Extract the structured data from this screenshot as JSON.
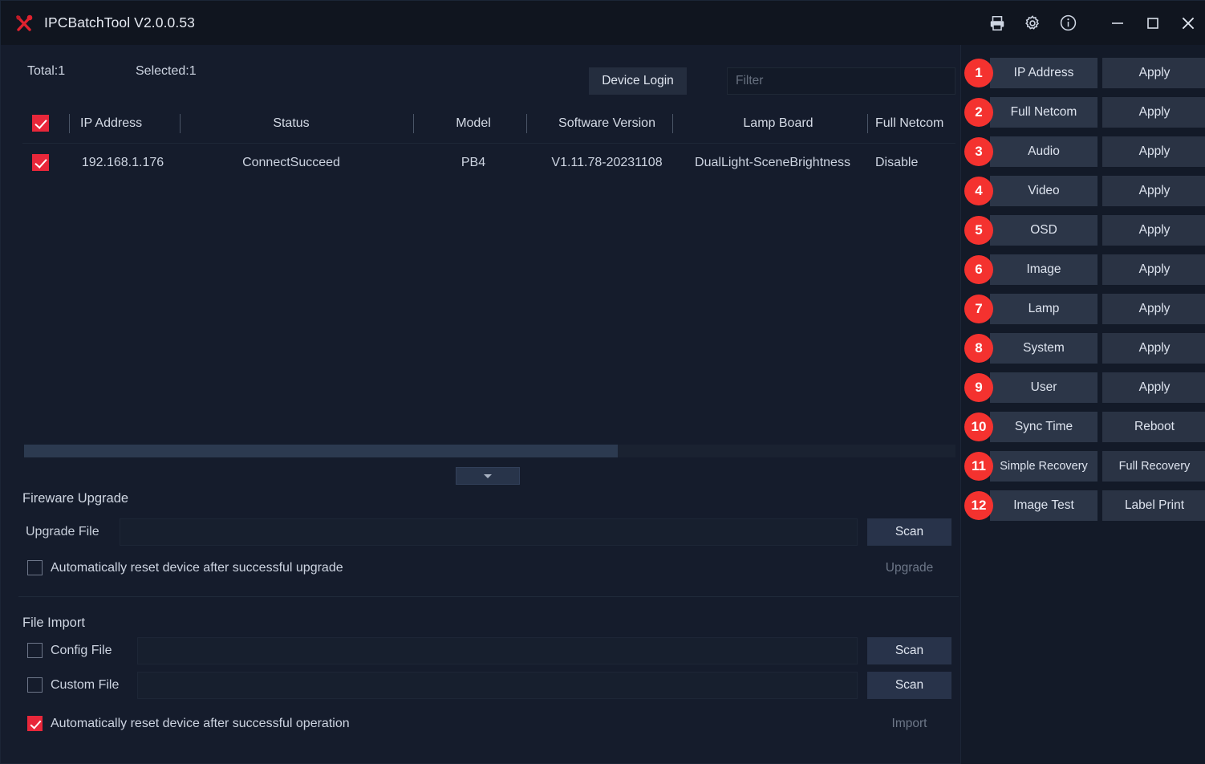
{
  "titlebar": {
    "app_title": "IPCBatchTool V2.0.0.53",
    "logo_icon": "crossed-tools-icon",
    "icons": [
      {
        "name": "printer-icon",
        "label": "Print"
      },
      {
        "name": "gear-icon",
        "label": "Settings"
      },
      {
        "name": "info-icon",
        "label": "About"
      }
    ],
    "window_controls": [
      {
        "name": "minimize-button",
        "glyph": "—"
      },
      {
        "name": "maximize-button",
        "glyph": "□"
      },
      {
        "name": "close-button",
        "glyph": "✕"
      }
    ]
  },
  "toolbar": {
    "total_label": "Total:1",
    "selected_label": "Selected:1",
    "device_login_label": "Device Login",
    "filter_placeholder": "Filter",
    "filter_value": ""
  },
  "table": {
    "columns": [
      {
        "key": "ip",
        "label": "IP Address"
      },
      {
        "key": "status",
        "label": "Status"
      },
      {
        "key": "model",
        "label": "Model"
      },
      {
        "key": "software",
        "label": "Software Version"
      },
      {
        "key": "lamp",
        "label": "Lamp Board"
      },
      {
        "key": "netcom",
        "label": "Full Netcom"
      }
    ],
    "header_checkbox_checked": true,
    "rows": [
      {
        "checked": true,
        "ip": "192.168.1.176",
        "status": "ConnectSucceed",
        "model": "PB4",
        "software": "V1.11.78-20231108",
        "lamp": "DualLight-SceneBrightness",
        "netcom": "Disable"
      }
    ]
  },
  "firmware": {
    "section_title": "Fireware Upgrade",
    "upgrade_file_label": "Upgrade File",
    "upgrade_file_value": "",
    "scan_label": "Scan",
    "upgrade_label": "Upgrade",
    "upgrade_disabled": true,
    "auto_reset_label": "Automatically reset device after successful upgrade",
    "auto_reset_checked": false
  },
  "file_import": {
    "section_title": "File Import",
    "config_file_label": "Config File",
    "config_file_checked": false,
    "config_file_value": "",
    "config_scan_label": "Scan",
    "custom_file_label": "Custom File",
    "custom_file_checked": false,
    "custom_file_value": "",
    "custom_scan_label": "Scan",
    "import_label": "Import",
    "import_disabled": true,
    "auto_reset_label": "Automatically reset device after successful operation",
    "auto_reset_checked": true
  },
  "right_panel": {
    "rows": [
      {
        "badge": "1",
        "primary": "IP Address",
        "secondary": "Apply"
      },
      {
        "badge": "2",
        "primary": "Full Netcom",
        "secondary": "Apply"
      },
      {
        "badge": "3",
        "primary": "Audio",
        "secondary": "Apply"
      },
      {
        "badge": "4",
        "primary": "Video",
        "secondary": "Apply"
      },
      {
        "badge": "5",
        "primary": "OSD",
        "secondary": "Apply"
      },
      {
        "badge": "6",
        "primary": "Image",
        "secondary": "Apply"
      },
      {
        "badge": "7",
        "primary": "Lamp",
        "secondary": "Apply"
      },
      {
        "badge": "8",
        "primary": "System",
        "secondary": "Apply"
      },
      {
        "badge": "9",
        "primary": "User",
        "secondary": "Apply"
      },
      {
        "badge": "10",
        "primary": "Sync Time",
        "secondary": "Reboot"
      },
      {
        "badge": "11",
        "primary": "Simple Recovery",
        "secondary": "Full Recovery"
      },
      {
        "badge": "12",
        "primary": "Image Test",
        "secondary": "Label Print"
      }
    ]
  },
  "colors": {
    "window_bg": "#151c2c",
    "titlebar_bg": "#10151f",
    "panel_bg": "#131a28",
    "button_bg": "#2c3648",
    "accent_red": "#e8273a",
    "badge_red": "#f4322f",
    "text_primary": "#dde3ee",
    "text_muted": "#6d7788"
  },
  "collapse_button": {
    "icon": "chevron-down-icon"
  },
  "scrollbar": {
    "orientation": "horizontal"
  }
}
